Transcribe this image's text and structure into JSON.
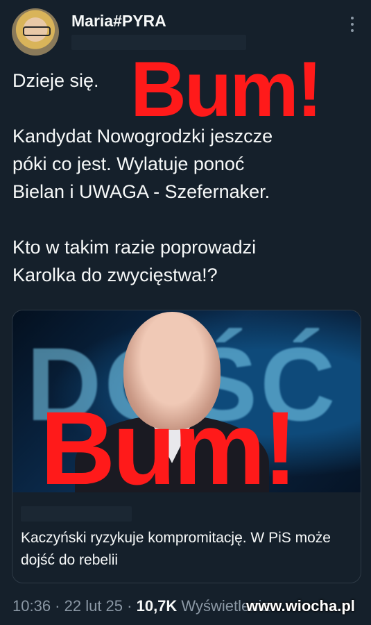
{
  "author": {
    "display_name": "Maria#PYRA",
    "avatar_icon": "user-avatar"
  },
  "tweet": {
    "lines": [
      "Dzieje się.",
      "Kandydat Nowogrodzki jeszcze",
      "póki co jest. Wylatuje ponoć",
      "Bielan i UWAGA - Szefernaker.",
      "Kto w takim razie poprowadzi",
      "Karolka do zwycięstwa!?"
    ]
  },
  "overlays": {
    "top": "Bum!",
    "card": "Bum!"
  },
  "card": {
    "bg_text": "DOŚĆ",
    "title": "Kaczyński ryzykuje kompromitację. W PiS może dojść do rebelii"
  },
  "meta": {
    "time": "10:36",
    "sep1": " · ",
    "date": "22 lut 25",
    "sep2": " · ",
    "views": "10,7K",
    "views_label": " Wyświetlenia"
  },
  "watermark": "www.wiocha.pl",
  "colors": {
    "background": "#15202b",
    "text": "#f7f9f9",
    "muted": "#8b98a5",
    "overlay_red": "#ff1a1a"
  }
}
